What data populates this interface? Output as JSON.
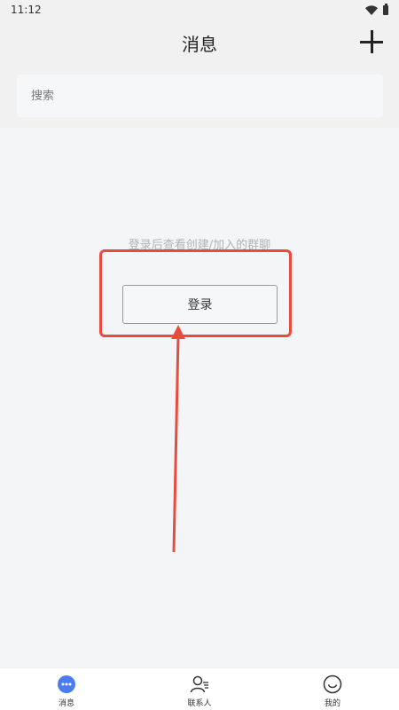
{
  "status_bar": {
    "time": "11:12"
  },
  "header": {
    "title": "消息"
  },
  "search": {
    "placeholder": "搜索"
  },
  "content": {
    "empty_message": "登录后查看创建/加入的群聊",
    "login_label": "登录"
  },
  "tabbar": {
    "items": [
      {
        "label": "消息",
        "icon": "chat-bubble-icon",
        "active": true
      },
      {
        "label": "联系人",
        "icon": "contacts-icon",
        "active": false
      },
      {
        "label": "我的",
        "icon": "smiley-icon",
        "active": false
      }
    ]
  },
  "colors": {
    "accent": "#4a7cf0",
    "annotation": "#e74c3c"
  }
}
